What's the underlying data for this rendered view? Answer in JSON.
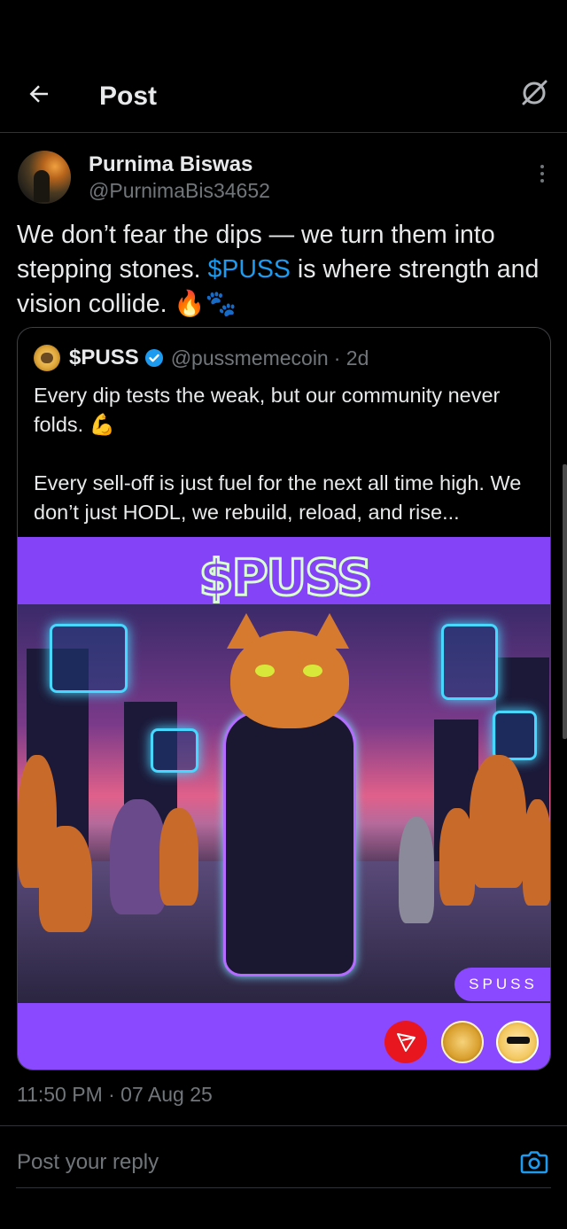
{
  "header": {
    "title": "Post",
    "back_icon": "arrow-left-icon",
    "grok_icon": "grok-icon"
  },
  "author": {
    "name": "Purnima Biswas",
    "handle": "@PurnimaBis34652"
  },
  "post": {
    "text_before": "We don’t fear the dips — we turn them into stepping stones. ",
    "cashtag": "$PUSS",
    "text_after": " is where strength and vision collide. 🔥🐾"
  },
  "quote": {
    "name": "$PUSS",
    "verified": true,
    "handle": "@pussmemecoin",
    "time": "· 2d",
    "text": "Every dip tests the weak, but our community never folds. 💪\n\nEvery sell-off is just fuel for the next all time high. We don’t just HODL, we rebuild, reload, and rise...",
    "media": {
      "banner_title": "$PUSS",
      "badge_label": "SPUSS"
    }
  },
  "timestamp": "11:50 PM · 07 Aug 25",
  "reply": {
    "placeholder": "Post your reply"
  },
  "colors": {
    "accent": "#1d9bf0",
    "muted": "#71767b",
    "background": "#000000",
    "media_purple": "#8443f7"
  }
}
